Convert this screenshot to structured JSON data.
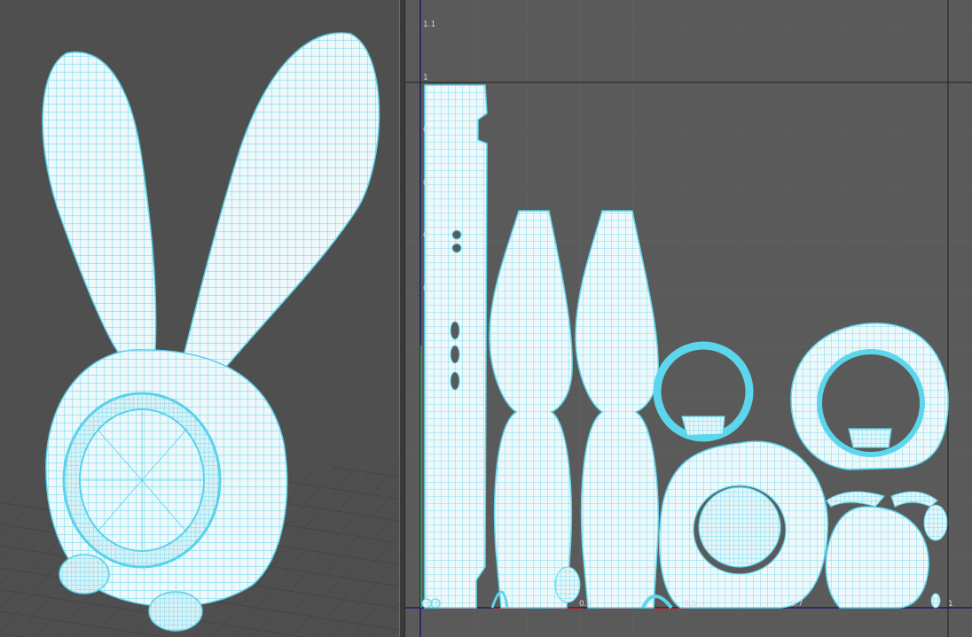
{
  "perspective_view": {
    "model": "rabbit-alarm-clock"
  },
  "uv_editor": {
    "axis_labels": {
      "v_1_1": "1.1",
      "v_1": "1",
      "v_09": "0.",
      "v_08": "0.",
      "v_07": "0.",
      "v_06": "0.",
      "u_03": "0.3",
      "u_05": "0.5",
      "u_07": "0.7",
      "u_1": "1"
    }
  },
  "colors": {
    "wire": "#5cd6ec",
    "shell": "#e9f6f9",
    "grid": "#626262",
    "bg_uv": "#5a5a5a",
    "bg_persp": "#4f4f4f"
  }
}
